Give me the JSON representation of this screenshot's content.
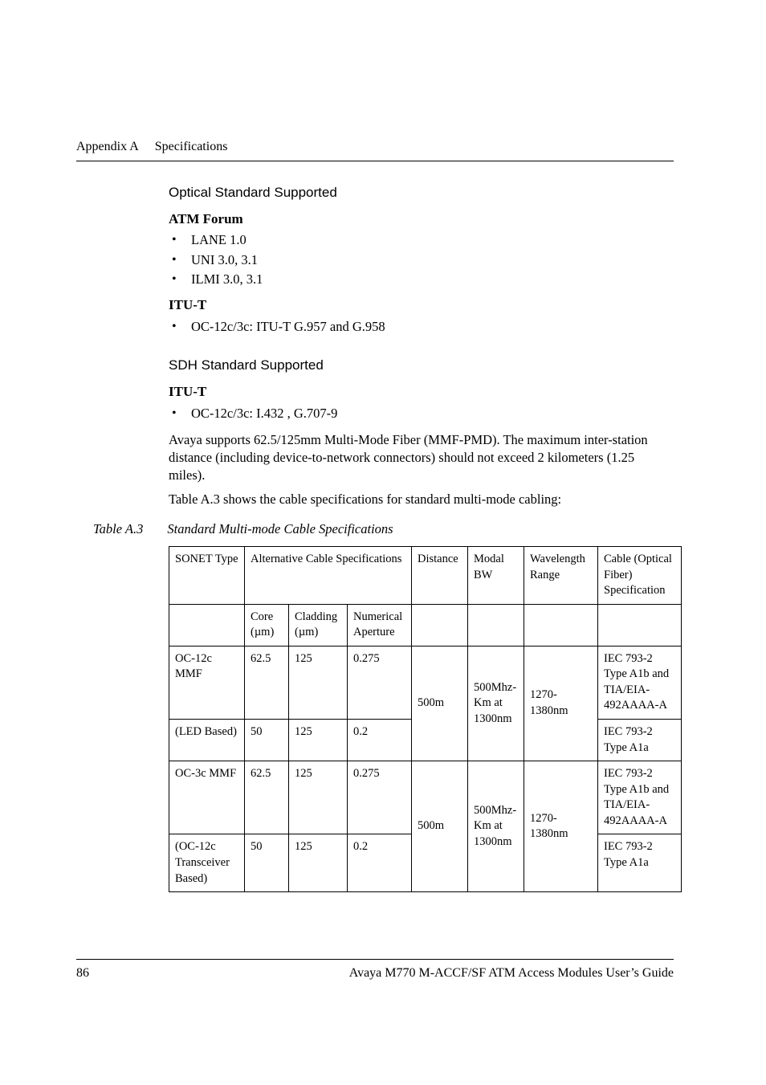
{
  "running_head": {
    "appendix": "Appendix A",
    "title": "Specifications"
  },
  "sections": {
    "optical_heading": "Optical Standard Supported",
    "atm_forum_heading": "ATM Forum",
    "atm_bullets": [
      "LANE 1.0",
      "UNI 3.0, 3.1",
      "ILMI 3.0, 3.1"
    ],
    "itu_t_heading": "ITU-T",
    "itu_optical_bullets": [
      "OC-12c/3c: ITU-T G.957 and G.958"
    ],
    "sdh_heading": "SDH Standard Supported",
    "itu_sdh_bullets": [
      "OC-12c/3c: I.432 , G.707-9"
    ],
    "para1": "Avaya supports 62.5/125mm Multi-Mode Fiber (MMF-PMD). The maximum inter-station distance (including device-to-network connectors) should not exceed 2 kilometers (1.25 miles).",
    "para2": "Table A.3 shows the cable specifications for standard multi-mode cabling:"
  },
  "table": {
    "caption_num": "Table A.3",
    "caption_title": "Standard Multi-mode Cable Specifications",
    "head": {
      "c0": "SONET Type",
      "c1": "Alternative Cable Specifications",
      "c2": "Distance",
      "c3": "Modal BW",
      "c4": "Wavelength Range",
      "c5": "Cable (Optical Fiber) Specification"
    },
    "subhead": {
      "core": "Core (µm)",
      "cladding": "Cladding (µm)",
      "numap": "Numerical Aperture"
    },
    "rows": [
      {
        "type": "OC-12c MMF",
        "core": "62.5",
        "clad": "125",
        "na": "0.275",
        "dist": "500m",
        "modal": "500Mhz-Km at 1300nm",
        "wave": "1270-1380nm",
        "cable": "IEC 793-2 Type A1b and TIA/EIA-492AAAA-A"
      },
      {
        "type": "(LED Based)",
        "core": "50",
        "clad": "125",
        "na": "0.2",
        "cable": "IEC 793-2 Type A1a"
      },
      {
        "type": "OC-3c MMF",
        "core": "62.5",
        "clad": "125",
        "na": "0.275",
        "dist": "500m",
        "modal": "500Mhz-Km at 1300nm",
        "wave": "1270-1380nm",
        "cable": "IEC 793-2 Type A1b and TIA/EIA-492AAAA-A"
      },
      {
        "type": "(OC-12c Transceiver Based)",
        "core": "50",
        "clad": "125",
        "na": "0.2",
        "cable": "IEC 793-2 Type A1a"
      }
    ]
  },
  "footer": {
    "page": "86",
    "title": "Avaya M770 M-ACCF/SF ATM Access Modules User’s Guide"
  }
}
